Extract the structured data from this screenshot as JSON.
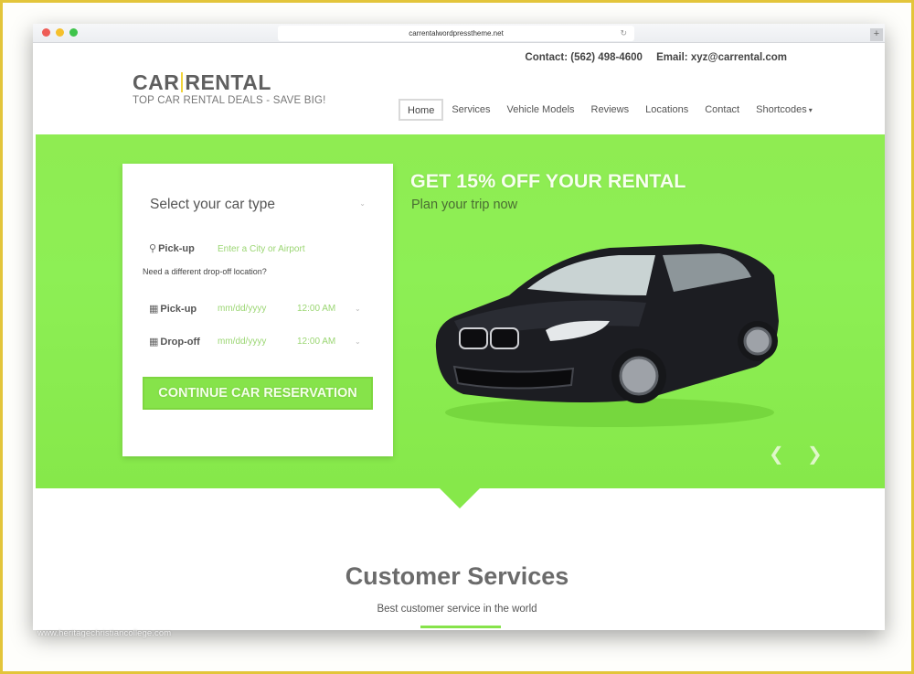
{
  "browser": {
    "url": "carrentalwordpresstheme.net",
    "reload_icon": "↻",
    "newtab_icon": "+"
  },
  "header": {
    "contact": "Contact: (562) 498-4600",
    "email": "Email: xyz@carrental.com",
    "logo_left": "CAR",
    "logo_right": "RENTAL",
    "tagline": "TOP CAR RENTAL DEALS - SAVE BIG!"
  },
  "nav": {
    "items": [
      {
        "label": "Home",
        "active": true
      },
      {
        "label": "Services"
      },
      {
        "label": "Vehicle Models"
      },
      {
        "label": "Reviews"
      },
      {
        "label": "Locations"
      },
      {
        "label": "Contact"
      },
      {
        "label": "Shortcodes"
      }
    ],
    "dropdown_caret": "▾"
  },
  "form": {
    "car_type": "Select your car type",
    "chevron": "⌄",
    "pickup_location_label": "Pick-up",
    "pickup_location_placeholder": "Enter a City or Airport",
    "dropoff_note": "Need a different drop-off location?",
    "pickup_date_label": "Pick-up",
    "pickup_date_placeholder": "mm/dd/yyyy",
    "pickup_time": "12:00 AM",
    "dropoff_date_label": "Drop-off",
    "dropoff_date_placeholder": "mm/dd/yyyy",
    "dropoff_time": "12:00 AM",
    "submit_label": "CONTINUE CAR RESERVATION",
    "pin_icon": "⚲",
    "calendar_icon": "▦"
  },
  "hero": {
    "title": "GET 15% OFF YOUR RENTAL",
    "subtitle": "Plan your trip now",
    "prev_icon": "❮",
    "next_icon": "❯"
  },
  "section": {
    "title": "Customer Services",
    "subtitle": "Best customer service in the world"
  },
  "watermark": "www.heritagechristiancollege.com",
  "colors": {
    "accent_green": "#86e34a",
    "logo_bar": "#f1d43a",
    "frame_border": "#e3c53a"
  }
}
